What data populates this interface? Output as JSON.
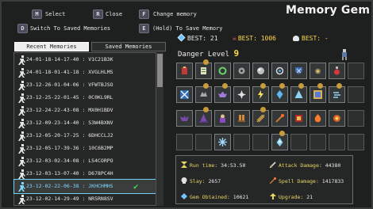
{
  "header": {
    "title": "Memory Gem",
    "hints": [
      {
        "key": "M",
        "label": "Select"
      },
      {
        "key": "R",
        "label": "Close"
      },
      {
        "key": "F",
        "label": "Change memory"
      },
      {
        "key": "D",
        "label": "Switch To Saved Memories"
      },
      {
        "key": "E",
        "label": "(Hold) To Save Memory"
      }
    ]
  },
  "best": {
    "gems": "BEST: 21",
    "danger": "BEST: 1006",
    "kills": "BEST: -"
  },
  "tabs": [
    {
      "label": "Recent Memories",
      "active": true
    },
    {
      "label": "Saved Memories",
      "active": false
    }
  ],
  "memories": [
    {
      "text": "24-01-18-14-17-40 : V1C21B3K"
    },
    {
      "text": "24-01-18-01-41-18 : XVGLHLMS"
    },
    {
      "text": "23-12-26-01-04-06 : VFWTBJSO"
    },
    {
      "text": "23-12-25-22-01-45 : 0C0KL9RL"
    },
    {
      "text": "23-12-24-22-43-08 : MX0H1BDV"
    },
    {
      "text": "23-12-09-23-14-40 : S3W4BXNV"
    },
    {
      "text": "23-12-05-20-17-25 : 6DHCCLJ2"
    },
    {
      "text": "23-12-05-17-39-36 : 10C6B2MP"
    },
    {
      "text": "23-12-03-02-34-08 : LS4CORPO"
    },
    {
      "text": "23-12-03-13-07-40 : D678PC4H"
    },
    {
      "text": "23-12-02-22-06-38 : JKHCHMHS",
      "selected": true
    },
    {
      "text": "23-12-02-14-29-49 : NR5RN8SV"
    }
  ],
  "danger": {
    "label": "Danger Level",
    "value": "9"
  },
  "icons": {
    "gem": "gem-icon",
    "skull": "skull-icon",
    "check": "checkmark-icon"
  },
  "colors": {
    "selected_text": "#7fd8ff",
    "label_yellow": "#e8d664",
    "danger_value": "#ffd84a"
  },
  "stats": {
    "run_time": {
      "label": "Run time:",
      "value": "34:53.50"
    },
    "slay": {
      "label": "Slay:",
      "value": "2657"
    },
    "gems_obtained": {
      "label": "Gem Obtained:",
      "value": "10621"
    },
    "attack_damage": {
      "label": "Attack Damage:",
      "value": "44380"
    },
    "spell_damage": {
      "label": "Spell Damage:",
      "value": "1417833"
    },
    "upgrade": {
      "label": "Upgrade:",
      "value": "21"
    }
  }
}
